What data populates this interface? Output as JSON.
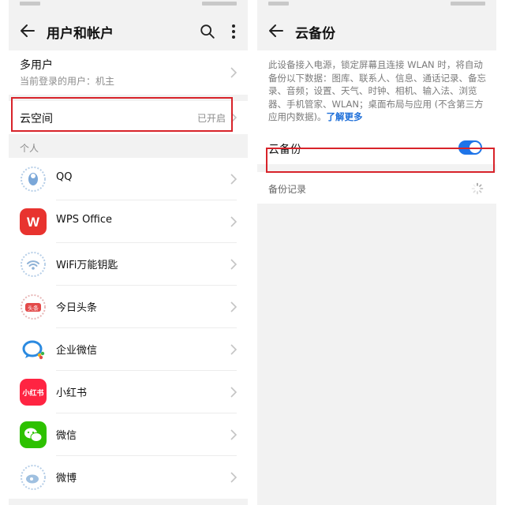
{
  "left_screen": {
    "title": "用户和帐户",
    "multiuser": {
      "title": "多用户",
      "subtitle": "当前登录的用户：机主"
    },
    "cloud": {
      "title": "云空间",
      "status": "已开启"
    },
    "section_personal": "个人",
    "apps": [
      {
        "label": "QQ",
        "icon": "qq-icon"
      },
      {
        "label": "WPS Office",
        "icon": "wps-icon",
        "glyph": "W"
      },
      {
        "label": "WiFi万能钥匙",
        "icon": "wifi-key-icon"
      },
      {
        "label": "今日头条",
        "icon": "toutiao-icon",
        "glyph": "头条"
      },
      {
        "label": "企业微信",
        "icon": "wework-icon"
      },
      {
        "label": "小红书",
        "icon": "xiaohongshu-icon",
        "glyph": "小红书"
      },
      {
        "label": "微信",
        "icon": "wechat-icon"
      },
      {
        "label": "微博",
        "icon": "weibo-icon"
      }
    ]
  },
  "right_screen": {
    "title": "云备份",
    "description": "此设备接入电源，锁定屏幕且连接 WLAN 时，将自动备份以下数据：图库、联系人、信息、通话记录、备忘录、音频；设置、天气、时钟、相机、输入法、浏览器、手机管家、WLAN；桌面布局与应用 (不含第三方应用内数据)。",
    "learn_more": "了解更多",
    "backup_toggle": {
      "label": "云备份",
      "enabled": true
    },
    "backup_records_label": "备份记录"
  },
  "colors": {
    "accent": "#1e74e8",
    "highlight": "#d8232a",
    "link": "#1e6fd9"
  }
}
